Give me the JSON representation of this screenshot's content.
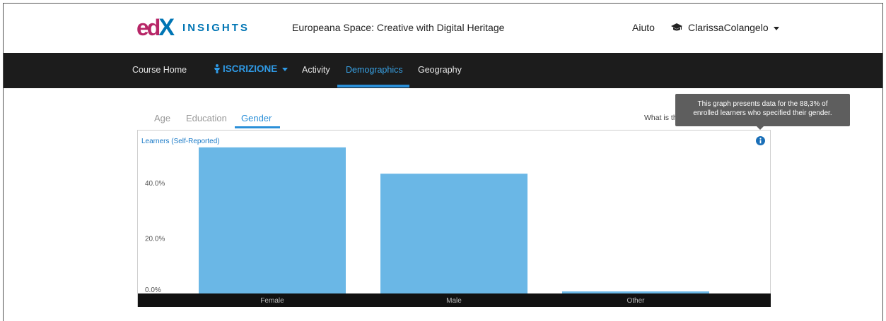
{
  "header": {
    "logo_text": "edX",
    "product": "INSIGHTS",
    "course_title": "Europeana Space: Creative with Digital Heritage",
    "help": "Aiuto",
    "username": "ClarissaColangelo"
  },
  "nav": {
    "items": [
      {
        "label": "Course Home"
      },
      {
        "label": "ISCRIZIONE"
      },
      {
        "label": "Activity"
      },
      {
        "label": "Demographics"
      },
      {
        "label": "Geography"
      }
    ],
    "active": "Demographics"
  },
  "tabs": [
    {
      "label": "Age"
    },
    {
      "label": "Education"
    },
    {
      "label": "Gender"
    }
  ],
  "active_tab": "Gender",
  "question": "What is the learner gender breakdown?",
  "tooltip": {
    "line1": "This graph presents data for the 88,3% of",
    "line2": "enrolled learners who specified their gender."
  },
  "chart_data": {
    "type": "bar",
    "ylabel": "Learners (Self-Reported)",
    "categories": [
      "Female",
      "Male",
      "Other"
    ],
    "values": [
      53.0,
      43.5,
      1.0
    ],
    "ylim": [
      0,
      54
    ],
    "yticks": [
      "0.0%",
      "20.0%",
      "40.0%"
    ],
    "ytick_values": [
      0,
      20,
      40
    ],
    "bar_color": "#6ab7e6",
    "grid": false
  },
  "colors": {
    "accent": "#2a8fd8",
    "nav_bg": "#1c1c1c"
  }
}
